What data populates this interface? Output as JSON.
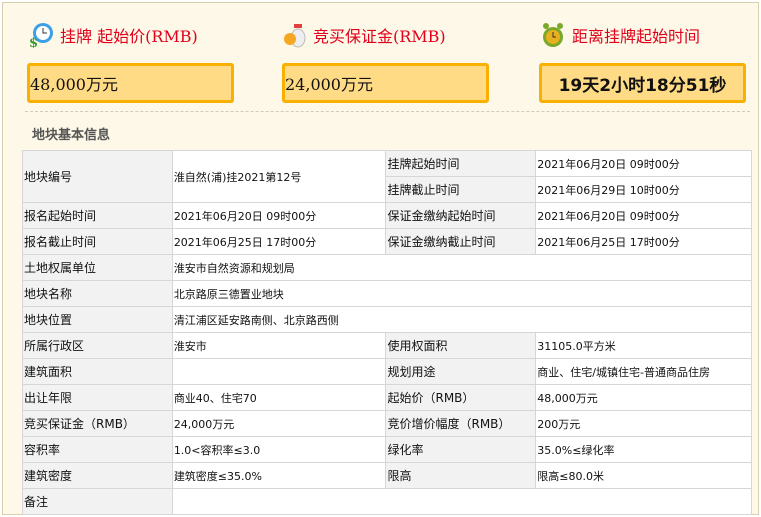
{
  "header": {
    "price_title": "挂牌 起始价(RMB)",
    "price_value": "48,000万元",
    "deposit_title": "竞买保证金(RMB)",
    "deposit_value": "24,000万元",
    "countdown_title": "距离挂牌起始时间",
    "countdown_value": "19天2小时18分51秒"
  },
  "section_title": "地块基本信息",
  "table": {
    "r1": {
      "l1": "地块编号",
      "v1": "淮自然(浦)挂2021第12号",
      "l2": "挂牌起始时间",
      "v2": "2021年06月20日 09时00分"
    },
    "r2": {
      "l2": "挂牌截止时间",
      "v2": "2021年06月29日 10时00分"
    },
    "r3": {
      "l1": "报名起始时间",
      "v1": "2021年06月20日 09时00分",
      "l2": "保证金缴纳起始时间",
      "v2": "2021年06月20日 09时00分"
    },
    "r4": {
      "l1": "报名截止时间",
      "v1": "2021年06月25日 17时00分",
      "l2": "保证金缴纳截止时间",
      "v2": "2021年06月25日 17时00分"
    },
    "r5": {
      "l1": "土地权属单位",
      "v1": "淮安市自然资源和规划局"
    },
    "r6": {
      "l1": "地块名称",
      "v1": "北京路原三德置业地块"
    },
    "r7": {
      "l1": "地块位置",
      "v1": "清江浦区延安路南侧、北京路西侧"
    },
    "r8": {
      "l1": "所属行政区",
      "v1": "淮安市",
      "l2": "使用权面积",
      "v2": "31105.0平方米"
    },
    "r9": {
      "l1": "建筑面积",
      "v1": "",
      "l2": "规划用途",
      "v2": "商业、住宅/城镇住宅-普通商品住房"
    },
    "r10": {
      "l1": "出让年限",
      "v1": "商业40、住宅70",
      "l2": "起始价（RMB）",
      "v2": "48,000万元"
    },
    "r11": {
      "l1": "竞买保证金（RMB）",
      "v1": "24,000万元",
      "l2": "竞价增价幅度（RMB）",
      "v2": "200万元"
    },
    "r12": {
      "l1": "容积率",
      "v1": "1.0<容积率≤3.0",
      "l2": "绿化率",
      "v2": "35.0%≤绿化率"
    },
    "r13": {
      "l1": "建筑密度",
      "v1": "建筑密度≤35.0%",
      "l2": "限高",
      "v2": "限高≤80.0米"
    },
    "r14": {
      "l1": "备注",
      "v1": ""
    }
  }
}
